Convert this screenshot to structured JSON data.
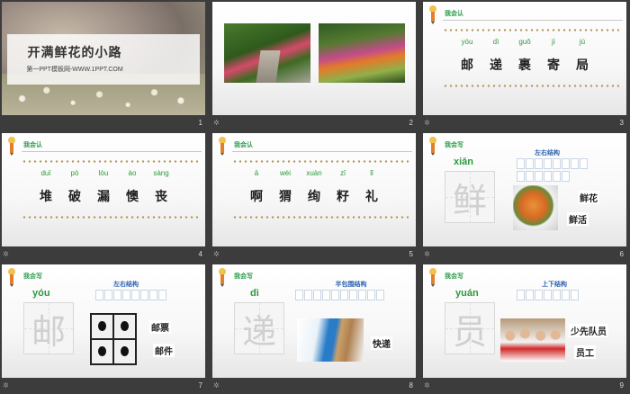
{
  "slides": [
    {
      "num": "1",
      "title": "开满鲜花的小路",
      "subtitle": "第一PPT模板网-WWW.1PPT.COM"
    },
    {
      "num": "2"
    },
    {
      "num": "3",
      "header": "我会认",
      "pinyin": [
        "yóu",
        "dì",
        "guǒ",
        "jì",
        "jú"
      ],
      "hanzi": [
        "邮",
        "递",
        "裹",
        "寄",
        "局"
      ]
    },
    {
      "num": "4",
      "header": "我会认",
      "pinyin": [
        "duī",
        "pò",
        "lòu",
        "ào",
        "sàng"
      ],
      "hanzi": [
        "堆",
        "破",
        "漏",
        "懊",
        "丧"
      ]
    },
    {
      "num": "5",
      "header": "我会认",
      "pinyin": [
        "ā",
        "wèi",
        "xuàn",
        "zǐ",
        "lǐ"
      ],
      "hanzi": [
        "啊",
        "猬",
        "绚",
        "籽",
        "礼"
      ]
    },
    {
      "num": "6",
      "header": "我会写",
      "pinyin": "xiān",
      "char": "鲜",
      "structure": "左右结构",
      "words": [
        "鲜花",
        "鲜活"
      ]
    },
    {
      "num": "7",
      "header": "我会写",
      "pinyin": "yóu",
      "char": "邮",
      "structure": "左右结构",
      "words": [
        "邮票",
        "邮件"
      ]
    },
    {
      "num": "8",
      "header": "我会写",
      "pinyin": "dì",
      "char": "递",
      "structure": "半包围结构",
      "words": [
        "快递"
      ]
    },
    {
      "num": "9",
      "header": "我会写",
      "pinyin": "yuán",
      "char": "员",
      "structure": "上下结构",
      "words": [
        "少先队员",
        "员工"
      ]
    }
  ],
  "icons": {
    "slide_marker": "star-icon",
    "mascot": "pencil-icon"
  }
}
